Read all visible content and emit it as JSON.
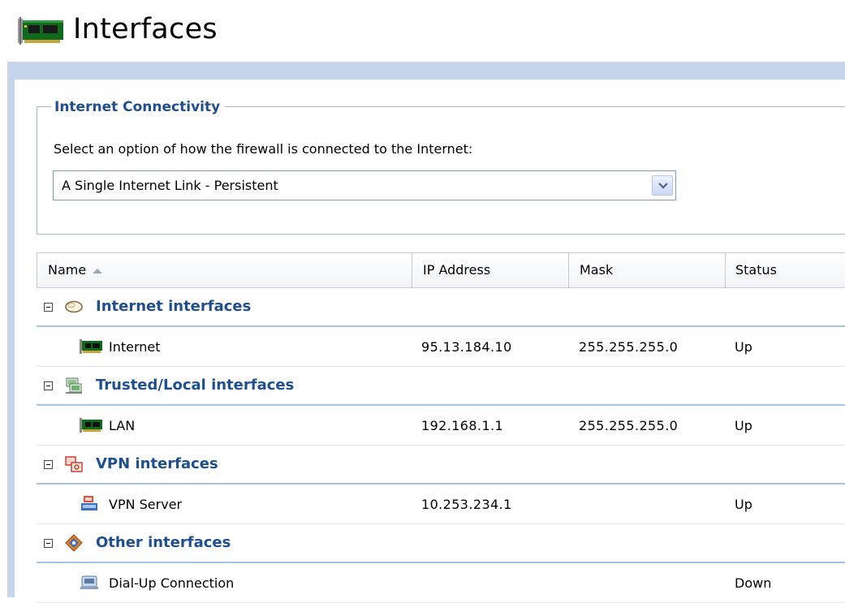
{
  "header": {
    "title": "Interfaces",
    "icon": "network-card-icon"
  },
  "connectivity": {
    "legend": "Internet Connectivity",
    "prompt": "Select an option of how the firewall is connected to the Internet:",
    "selected": "A Single Internet Link - Persistent"
  },
  "grid": {
    "columns": {
      "name": "Name",
      "ip": "IP Address",
      "mask": "Mask",
      "status": "Status"
    },
    "sort": {
      "column": "Name",
      "direction": "ascending"
    },
    "groups": [
      {
        "label": "Internet interfaces",
        "icon": "cloud-icon",
        "items": [
          {
            "name": "Internet",
            "ip": "95.13.184.10",
            "mask": "255.255.255.0",
            "status": "Up",
            "icon": "network-card-icon"
          }
        ]
      },
      {
        "label": "Trusted/Local interfaces",
        "icon": "local-network-icon",
        "items": [
          {
            "name": "LAN",
            "ip": "192.168.1.1",
            "mask": "255.255.255.0",
            "status": "Up",
            "icon": "network-card-icon"
          }
        ]
      },
      {
        "label": "VPN interfaces",
        "icon": "vpn-icon",
        "items": [
          {
            "name": "VPN Server",
            "ip": "10.253.234.1",
            "mask": "",
            "status": "Up",
            "icon": "vpn-server-icon"
          }
        ]
      },
      {
        "label": "Other interfaces",
        "icon": "other-interfaces-icon",
        "items": [
          {
            "name": "Dial-Up Connection",
            "ip": "",
            "mask": "",
            "status": "Down",
            "icon": "dialup-icon"
          }
        ]
      }
    ]
  },
  "colors": {
    "accent": "#1f4f8f",
    "panel_frame": "#c6d5ec",
    "group_underline": "#a9c1e2"
  }
}
